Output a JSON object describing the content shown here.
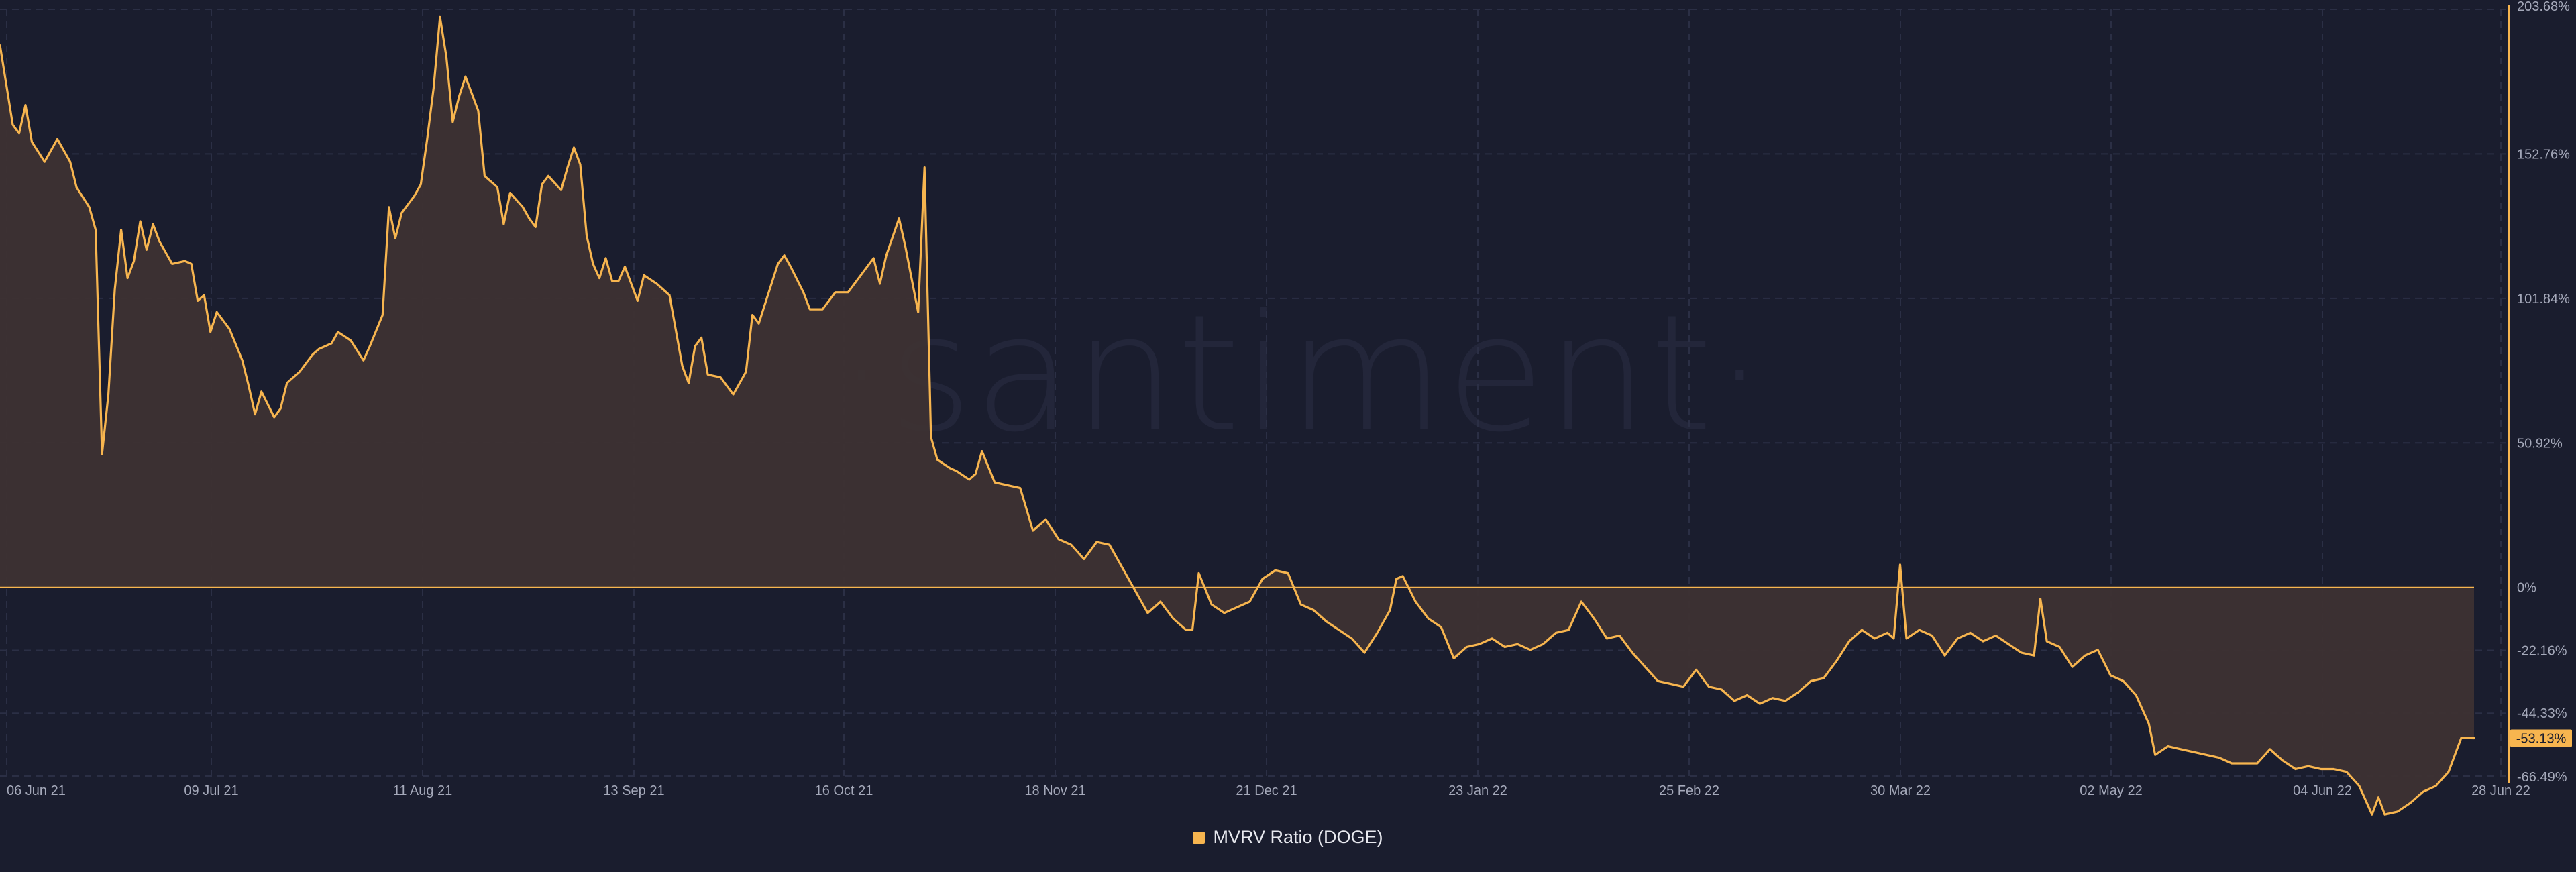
{
  "watermark": "·santiment·",
  "colors": {
    "background": "#1a1d2e",
    "series": "#f7b54f",
    "area_fill": "#3d3233",
    "grid": "#2b2f45",
    "zero_line": "#f7b54f"
  },
  "legend": {
    "label": "MVRV Ratio (DOGE)"
  },
  "current_value_label": "-53.13%",
  "chart_data": {
    "type": "area",
    "title": "",
    "xlabel": "",
    "ylabel": "",
    "x_ticks": [
      "06 Jun 21",
      "09 Jul 21",
      "11 Aug 21",
      "13 Sep 21",
      "16 Oct 21",
      "18 Nov 21",
      "21 Dec 21",
      "23 Jan 22",
      "25 Feb 22",
      "30 Mar 22",
      "02 May 22",
      "04 Jun 22",
      "28 Jun 22"
    ],
    "y_ticks": [
      "203.68%",
      "152.76%",
      "101.84%",
      "50.92%",
      "0%",
      "-22.16%",
      "-44.33%",
      "-66.49%"
    ],
    "y_tick_values": [
      203.68,
      152.76,
      101.84,
      50.92,
      0,
      -22.16,
      -44.33,
      -66.49
    ],
    "ylim": [
      -66.49,
      203.68
    ],
    "xlim": [
      "2021-06-05",
      "2022-06-28"
    ],
    "grid": true,
    "legend_position": "bottom-center",
    "series": [
      {
        "name": "MVRV Ratio (DOGE)",
        "points": [
          [
            "2021-06-05",
            191
          ],
          [
            "2021-06-07",
            163
          ],
          [
            "2021-06-08",
            160
          ],
          [
            "2021-06-09",
            170
          ],
          [
            "2021-06-10",
            157
          ],
          [
            "2021-06-12",
            150
          ],
          [
            "2021-06-14",
            158
          ],
          [
            "2021-06-16",
            150
          ],
          [
            "2021-06-17",
            141
          ],
          [
            "2021-06-19",
            134
          ],
          [
            "2021-06-20",
            126
          ],
          [
            "2021-06-21",
            47
          ],
          [
            "2021-06-22",
            68
          ],
          [
            "2021-06-23",
            105
          ],
          [
            "2021-06-24",
            126
          ],
          [
            "2021-06-25",
            109
          ],
          [
            "2021-06-26",
            115
          ],
          [
            "2021-06-27",
            129
          ],
          [
            "2021-06-28",
            119
          ],
          [
            "2021-06-29",
            128
          ],
          [
            "2021-06-30",
            122
          ],
          [
            "2021-07-02",
            114
          ],
          [
            "2021-07-04",
            115
          ],
          [
            "2021-07-05",
            114
          ],
          [
            "2021-07-06",
            101
          ],
          [
            "2021-07-07",
            103
          ],
          [
            "2021-07-08",
            90
          ],
          [
            "2021-07-09",
            97
          ],
          [
            "2021-07-11",
            91
          ],
          [
            "2021-07-13",
            80
          ],
          [
            "2021-07-14",
            71
          ],
          [
            "2021-07-15",
            61
          ],
          [
            "2021-07-16",
            69
          ],
          [
            "2021-07-18",
            60
          ],
          [
            "2021-07-19",
            63
          ],
          [
            "2021-07-20",
            72
          ],
          [
            "2021-07-22",
            76
          ],
          [
            "2021-07-24",
            82
          ],
          [
            "2021-07-25",
            84
          ],
          [
            "2021-07-27",
            86
          ],
          [
            "2021-07-28",
            90
          ],
          [
            "2021-07-30",
            87
          ],
          [
            "2021-08-01",
            80
          ],
          [
            "2021-08-02",
            85
          ],
          [
            "2021-08-04",
            96
          ],
          [
            "2021-08-05",
            134
          ],
          [
            "2021-08-06",
            123
          ],
          [
            "2021-08-07",
            132
          ],
          [
            "2021-08-09",
            138
          ],
          [
            "2021-08-10",
            142
          ],
          [
            "2021-08-11",
            158
          ],
          [
            "2021-08-12",
            176
          ],
          [
            "2021-08-13",
            201
          ],
          [
            "2021-08-14",
            187
          ],
          [
            "2021-08-15",
            164
          ],
          [
            "2021-08-16",
            173
          ],
          [
            "2021-08-17",
            180
          ],
          [
            "2021-08-19",
            168
          ],
          [
            "2021-08-20",
            145
          ],
          [
            "2021-08-21",
            143
          ],
          [
            "2021-08-22",
            141
          ],
          [
            "2021-08-23",
            128
          ],
          [
            "2021-08-24",
            139
          ],
          [
            "2021-08-26",
            134
          ],
          [
            "2021-08-27",
            130
          ],
          [
            "2021-08-28",
            127
          ],
          [
            "2021-08-29",
            142
          ],
          [
            "2021-08-30",
            145
          ],
          [
            "2021-09-01",
            140
          ],
          [
            "2021-09-02",
            148
          ],
          [
            "2021-09-03",
            155
          ],
          [
            "2021-09-04",
            149
          ],
          [
            "2021-09-05",
            124
          ],
          [
            "2021-09-06",
            114
          ],
          [
            "2021-09-07",
            109
          ],
          [
            "2021-09-08",
            116
          ],
          [
            "2021-09-09",
            108
          ],
          [
            "2021-09-10",
            108
          ],
          [
            "2021-09-11",
            113
          ],
          [
            "2021-09-13",
            101
          ],
          [
            "2021-09-14",
            110
          ],
          [
            "2021-09-16",
            107
          ],
          [
            "2021-09-18",
            103
          ],
          [
            "2021-09-20",
            78
          ],
          [
            "2021-09-21",
            72
          ],
          [
            "2021-09-22",
            85
          ],
          [
            "2021-09-23",
            88
          ],
          [
            "2021-09-24",
            75
          ],
          [
            "2021-09-26",
            74
          ],
          [
            "2021-09-28",
            68
          ],
          [
            "2021-09-30",
            76
          ],
          [
            "2021-10-01",
            96
          ],
          [
            "2021-10-02",
            93
          ],
          [
            "2021-10-03",
            100
          ],
          [
            "2021-10-05",
            114
          ],
          [
            "2021-10-06",
            117
          ],
          [
            "2021-10-07",
            113
          ],
          [
            "2021-10-09",
            104
          ],
          [
            "2021-10-10",
            98
          ],
          [
            "2021-10-12",
            98
          ],
          [
            "2021-10-14",
            104
          ],
          [
            "2021-10-16",
            104
          ],
          [
            "2021-10-18",
            110
          ],
          [
            "2021-10-20",
            116
          ],
          [
            "2021-10-21",
            107
          ],
          [
            "2021-10-22",
            117
          ],
          [
            "2021-10-24",
            130
          ],
          [
            "2021-10-25",
            120
          ],
          [
            "2021-10-27",
            97
          ],
          [
            "2021-10-28",
            148
          ],
          [
            "2021-10-29",
            53
          ],
          [
            "2021-10-30",
            45
          ],
          [
            "2021-11-01",
            42
          ],
          [
            "2021-11-02",
            41
          ],
          [
            "2021-11-04",
            38
          ],
          [
            "2021-11-05",
            40
          ],
          [
            "2021-11-06",
            48
          ],
          [
            "2021-11-08",
            37
          ],
          [
            "2021-11-10",
            36
          ],
          [
            "2021-11-12",
            35
          ],
          [
            "2021-11-14",
            20
          ],
          [
            "2021-11-16",
            24
          ],
          [
            "2021-11-18",
            17
          ],
          [
            "2021-11-20",
            15
          ],
          [
            "2021-11-22",
            10
          ],
          [
            "2021-11-24",
            16
          ],
          [
            "2021-11-26",
            15
          ],
          [
            "2021-11-28",
            7
          ],
          [
            "2021-12-01",
            -5
          ],
          [
            "2021-12-02",
            -9
          ],
          [
            "2021-12-04",
            -5
          ],
          [
            "2021-12-06",
            -11
          ],
          [
            "2021-12-08",
            -15
          ],
          [
            "2021-12-09",
            -15
          ],
          [
            "2021-12-10",
            5
          ],
          [
            "2021-12-12",
            -6
          ],
          [
            "2021-12-14",
            -9
          ],
          [
            "2021-12-16",
            -7
          ],
          [
            "2021-12-18",
            -5
          ],
          [
            "2021-12-20",
            3
          ],
          [
            "2021-12-22",
            6
          ],
          [
            "2021-12-24",
            5
          ],
          [
            "2021-12-26",
            -6
          ],
          [
            "2021-12-28",
            -8
          ],
          [
            "2021-12-30",
            -12
          ],
          [
            "2022-01-01",
            -15
          ],
          [
            "2022-01-03",
            -18
          ],
          [
            "2022-01-05",
            -23
          ],
          [
            "2022-01-07",
            -16
          ],
          [
            "2022-01-09",
            -8
          ],
          [
            "2022-01-10",
            3
          ],
          [
            "2022-01-11",
            4
          ],
          [
            "2022-01-13",
            -5
          ],
          [
            "2022-01-15",
            -11
          ],
          [
            "2022-01-17",
            -14
          ],
          [
            "2022-01-19",
            -25
          ],
          [
            "2022-01-21",
            -21
          ],
          [
            "2022-01-23",
            -20
          ],
          [
            "2022-01-25",
            -18
          ],
          [
            "2022-01-27",
            -21
          ],
          [
            "2022-01-29",
            -20
          ],
          [
            "2022-01-31",
            -22
          ],
          [
            "2022-02-02",
            -20
          ],
          [
            "2022-02-04",
            -16
          ],
          [
            "2022-02-06",
            -15
          ],
          [
            "2022-02-08",
            -5
          ],
          [
            "2022-02-10",
            -11
          ],
          [
            "2022-02-12",
            -18
          ],
          [
            "2022-02-14",
            -17
          ],
          [
            "2022-02-16",
            -23
          ],
          [
            "2022-02-18",
            -28
          ],
          [
            "2022-02-20",
            -33
          ],
          [
            "2022-02-22",
            -34
          ],
          [
            "2022-02-24",
            -35
          ],
          [
            "2022-02-26",
            -29
          ],
          [
            "2022-02-28",
            -35
          ],
          [
            "2022-03-02",
            -36
          ],
          [
            "2022-03-04",
            -40
          ],
          [
            "2022-03-06",
            -38
          ],
          [
            "2022-03-08",
            -41
          ],
          [
            "2022-03-10",
            -39
          ],
          [
            "2022-03-12",
            -40
          ],
          [
            "2022-03-14",
            -37
          ],
          [
            "2022-03-16",
            -33
          ],
          [
            "2022-03-18",
            -32
          ],
          [
            "2022-03-20",
            -26
          ],
          [
            "2022-03-22",
            -19
          ],
          [
            "2022-03-24",
            -15
          ],
          [
            "2022-03-26",
            -18
          ],
          [
            "2022-03-28",
            -16
          ],
          [
            "2022-03-29",
            -18
          ],
          [
            "2022-03-30",
            8
          ],
          [
            "2022-03-31",
            -18
          ],
          [
            "2022-04-02",
            -15
          ],
          [
            "2022-04-04",
            -17
          ],
          [
            "2022-04-06",
            -24
          ],
          [
            "2022-04-08",
            -18
          ],
          [
            "2022-04-10",
            -16
          ],
          [
            "2022-04-12",
            -19
          ],
          [
            "2022-04-14",
            -17
          ],
          [
            "2022-04-16",
            -20
          ],
          [
            "2022-04-18",
            -23
          ],
          [
            "2022-04-20",
            -24
          ],
          [
            "2022-04-21",
            -4
          ],
          [
            "2022-04-22",
            -19
          ],
          [
            "2022-04-24",
            -21
          ],
          [
            "2022-04-26",
            -28
          ],
          [
            "2022-04-28",
            -24
          ],
          [
            "2022-04-30",
            -22
          ],
          [
            "2022-05-02",
            -31
          ],
          [
            "2022-05-04",
            -33
          ],
          [
            "2022-05-06",
            -38
          ],
          [
            "2022-05-08",
            -48
          ],
          [
            "2022-05-09",
            -59
          ],
          [
            "2022-05-11",
            -56
          ],
          [
            "2022-05-13",
            -57
          ],
          [
            "2022-05-15",
            -58
          ],
          [
            "2022-05-17",
            -59
          ],
          [
            "2022-05-19",
            -60
          ],
          [
            "2022-05-21",
            -62
          ],
          [
            "2022-05-23",
            -62
          ],
          [
            "2022-05-25",
            -62
          ],
          [
            "2022-05-27",
            -57
          ],
          [
            "2022-05-29",
            -61
          ],
          [
            "2022-05-31",
            -64
          ],
          [
            "2022-06-02",
            -63
          ],
          [
            "2022-06-04",
            -64
          ],
          [
            "2022-06-06",
            -64
          ],
          [
            "2022-06-08",
            -65
          ],
          [
            "2022-06-10",
            -70
          ],
          [
            "2022-06-12",
            -80
          ],
          [
            "2022-06-13",
            -74
          ],
          [
            "2022-06-14",
            -80
          ],
          [
            "2022-06-16",
            -79
          ],
          [
            "2022-06-18",
            -76
          ],
          [
            "2022-06-20",
            -72
          ],
          [
            "2022-06-22",
            -70
          ],
          [
            "2022-06-24",
            -65
          ],
          [
            "2022-06-26",
            -53
          ],
          [
            "2022-06-28",
            -53.13
          ]
        ]
      }
    ]
  }
}
